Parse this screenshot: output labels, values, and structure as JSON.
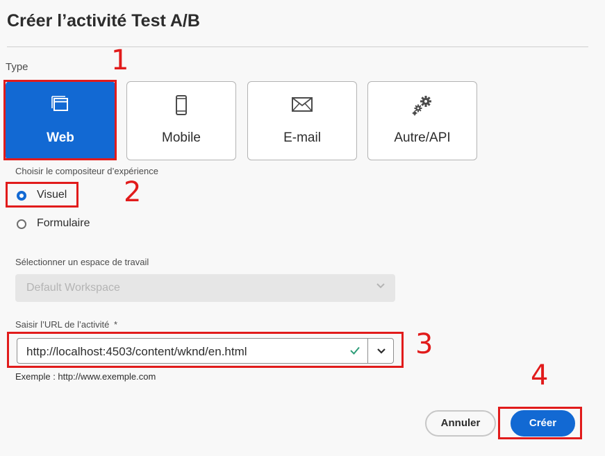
{
  "dialog": {
    "title": "Créer l’activité Test A/B"
  },
  "type_section": {
    "label": "Type",
    "options": [
      {
        "label": "Web",
        "icon": "browser-window-icon",
        "selected": true
      },
      {
        "label": "Mobile",
        "icon": "mobile-phone-icon",
        "selected": false
      },
      {
        "label": "E-mail",
        "icon": "envelope-icon",
        "selected": false
      },
      {
        "label": "Autre/API",
        "icon": "gears-icon",
        "selected": false
      }
    ]
  },
  "composer": {
    "label": "Choisir le compositeur d’expérience",
    "options": [
      {
        "label": "Visuel",
        "selected": true
      },
      {
        "label": "Formulaire",
        "selected": false
      }
    ]
  },
  "workspace": {
    "label": "Sélectionner un espace de travail",
    "value": "Default Workspace",
    "disabled": true
  },
  "url": {
    "label": "Saisir l’URL de l’activité",
    "required_mark": "*",
    "value": "http://localhost:4503/content/wknd/en.html",
    "example": "Exemple : http://www.exemple.com",
    "valid": true
  },
  "buttons": {
    "cancel": "Annuler",
    "create": "Créer"
  },
  "annotations": [
    "1",
    "2",
    "3",
    "4"
  ],
  "colors": {
    "accent": "#1269d3",
    "annotation": "#e11b1b",
    "valid": "#2d9d78"
  }
}
